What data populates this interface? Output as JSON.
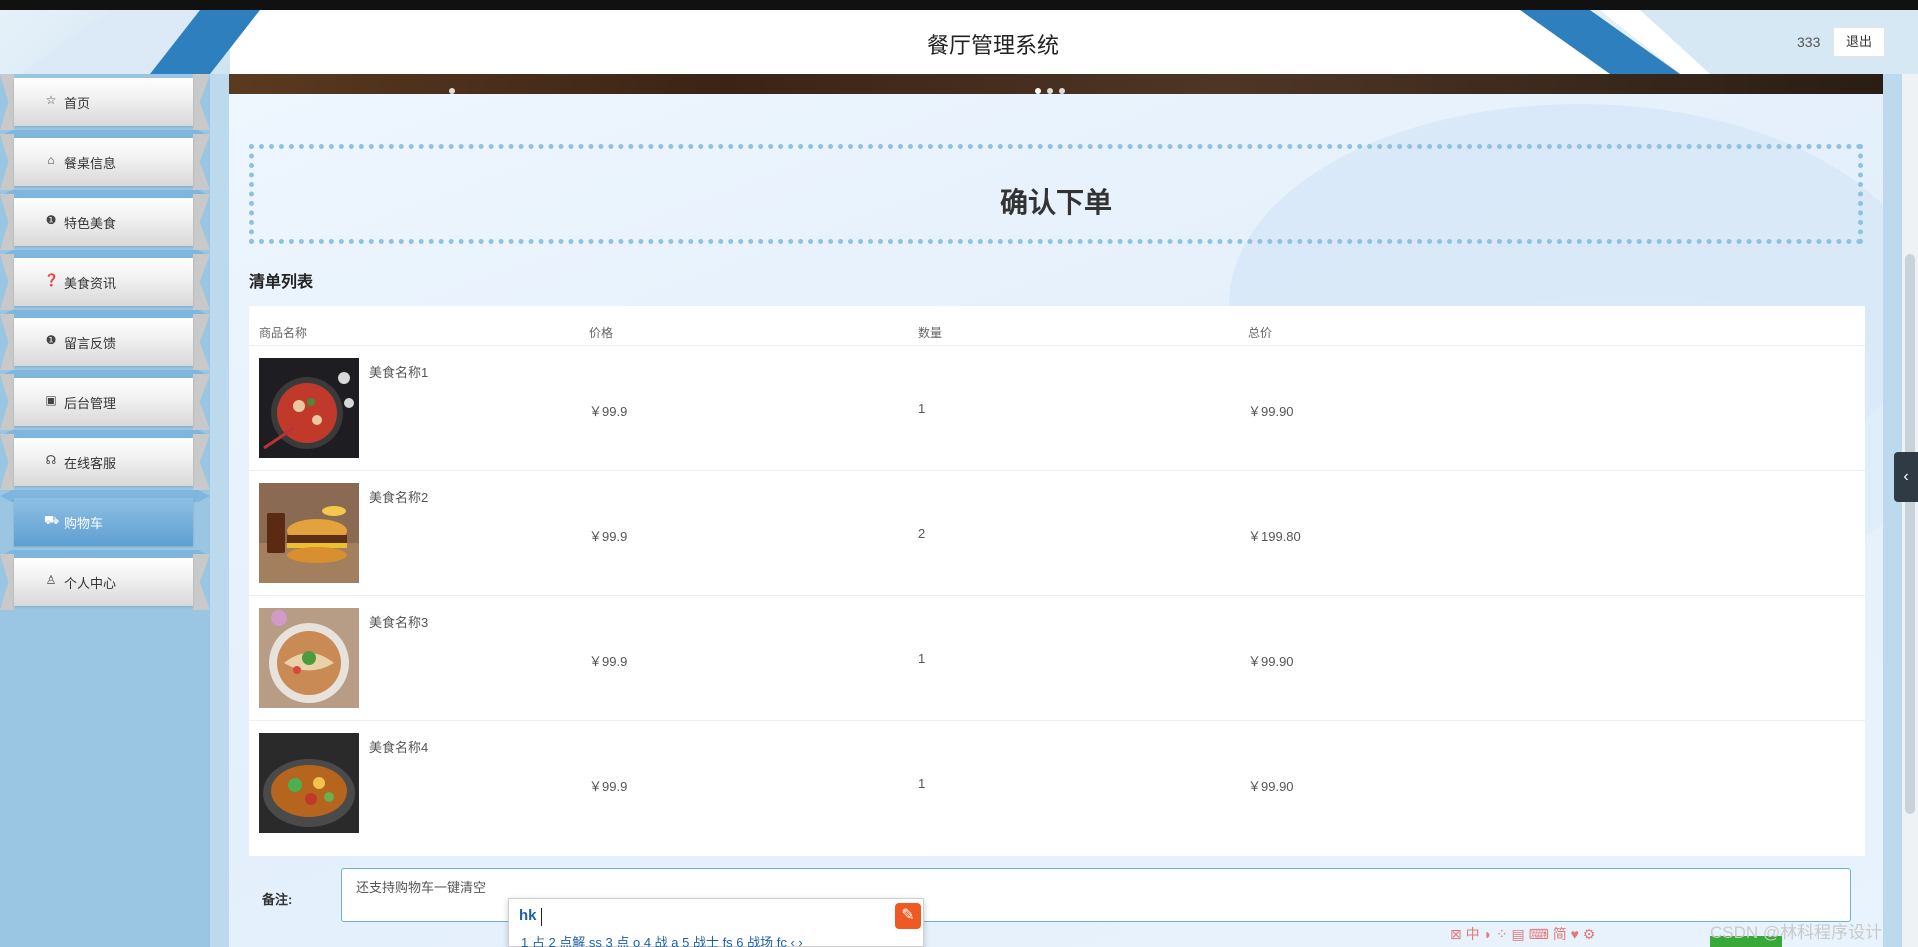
{
  "app": {
    "title": "餐厅管理系统",
    "user": "333",
    "logout_label": "退出"
  },
  "sidebar": {
    "items": [
      {
        "label": "首页",
        "icon": "star-icon",
        "glyph": "☆"
      },
      {
        "label": "餐桌信息",
        "icon": "bag-icon",
        "glyph": "⌂"
      },
      {
        "label": "特色美食",
        "icon": "info-icon",
        "glyph": "❶"
      },
      {
        "label": "美食资讯",
        "icon": "question-icon",
        "glyph": "❓"
      },
      {
        "label": "留言反馈",
        "icon": "info-circle-icon",
        "glyph": "❶"
      },
      {
        "label": "后台管理",
        "icon": "briefcase-icon",
        "glyph": "▣"
      },
      {
        "label": "在线客服",
        "icon": "headset-icon",
        "glyph": "☊"
      },
      {
        "label": "购物车",
        "icon": "cart-icon",
        "glyph": "⛟"
      },
      {
        "label": "个人中心",
        "icon": "user-icon",
        "glyph": "♙"
      }
    ],
    "active_index": 7
  },
  "main": {
    "confirm_title": "确认下单",
    "list_heading": "清单列表",
    "table": {
      "headers": [
        "商品名称",
        "价格",
        "数量",
        "总价"
      ],
      "rows": [
        {
          "name": "美食名称1",
          "price": "￥99.9",
          "qty": "1",
          "total": "￥99.90"
        },
        {
          "name": "美食名称2",
          "price": "￥99.9",
          "qty": "2",
          "total": "￥199.80"
        },
        {
          "name": "美食名称3",
          "price": "￥99.9",
          "qty": "1",
          "total": "￥99.90"
        },
        {
          "name": "美食名称4",
          "price": "￥99.9",
          "qty": "1",
          "total": "￥99.90"
        }
      ]
    },
    "remark_label": "备注:",
    "remark_value": "还支持购物车一键清空"
  },
  "ime": {
    "input": "hk",
    "candidates": "1 占  2 点解 ss  3 点 o  4 战 a  5 战士 fs  6 战场 fc  ‹ ›"
  },
  "tray_text": "⊠ 中 ◗ ⁘ ▤ ⌨ 简 ♥ ⚙",
  "watermark": "CSDN @林科程序设计"
}
